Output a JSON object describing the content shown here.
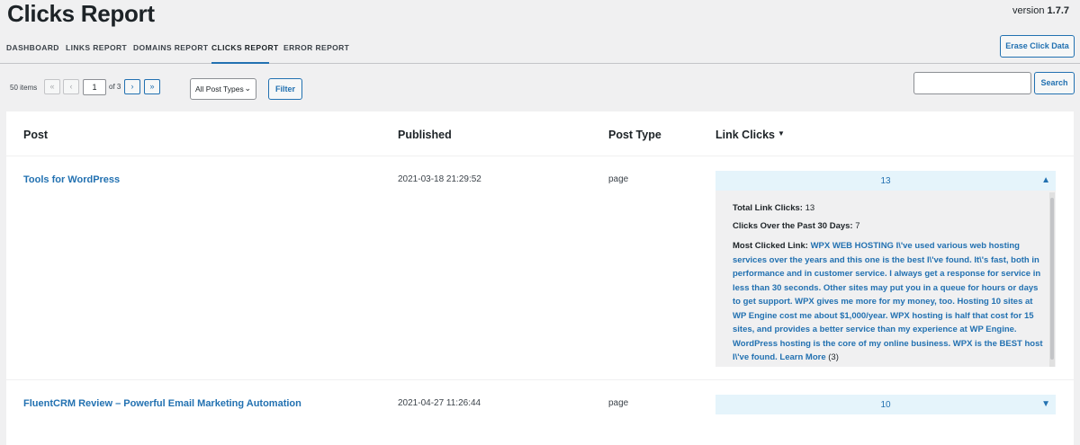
{
  "header": {
    "title": "Clicks Report",
    "version_label": "version",
    "version_value": "1.7.7"
  },
  "tabs": [
    {
      "label": "Dashboard"
    },
    {
      "label": "Links Report"
    },
    {
      "label": "Domains Report"
    },
    {
      "label": "Clicks Report",
      "active": true
    },
    {
      "label": "Error Report"
    }
  ],
  "toolbar": {
    "erase_label": "Erase Click Data",
    "items_count": "50 items",
    "first_page": "«",
    "prev_page": "‹",
    "current_page": "1",
    "of_pages": "of 3",
    "next_page": "›",
    "last_page": "»",
    "post_type_selected": "All Post Types",
    "filter_label": "Filter",
    "search_label": "Search",
    "search_value": ""
  },
  "table": {
    "columns": [
      "Post",
      "Published",
      "Post Type",
      "Link Clicks"
    ],
    "rows": [
      {
        "post": "Tools for WordPress",
        "published": "2021-03-18 21:29:52",
        "post_type": "page",
        "clicks": "13",
        "expanded": true,
        "details": {
          "total_label": "Total Link Clicks:",
          "total_value": "13",
          "past30_label": "Clicks Over the Past 30 Days:",
          "past30_value": "7",
          "most_label": "Most Clicked Link:",
          "most_link": "WPX WEB HOSTING I\\'ve used various web hosting services over the years and this one is the best I\\'ve found. It\\'s fast, both in performance and in customer service. I always get a response for service in less than 30 seconds. Other sites may put you in a queue for hours or days to get support. WPX gives me more for my money, too. Hosting 10 sites at WP Engine cost me about $1,000/year. WPX hosting is half that cost for 15 sites, and provides a better service than my experience at WP Engine. WordPress hosting is the core of my online business. WPX is the BEST host I\\'ve found. Learn More",
          "most_count": "(3)"
        }
      },
      {
        "post": "FluentCRM Review – Powerful Email Marketing Automation",
        "published": "2021-04-27 11:26:44",
        "post_type": "page",
        "clicks": "10",
        "expanded": false
      }
    ]
  },
  "icons": {
    "sort": "sort-desc-icon",
    "collapse": "chevron-up-icon",
    "expand": "chevron-down-icon"
  },
  "colors": {
    "accent": "#2271b1",
    "panel_head": "#e5f4fb"
  }
}
